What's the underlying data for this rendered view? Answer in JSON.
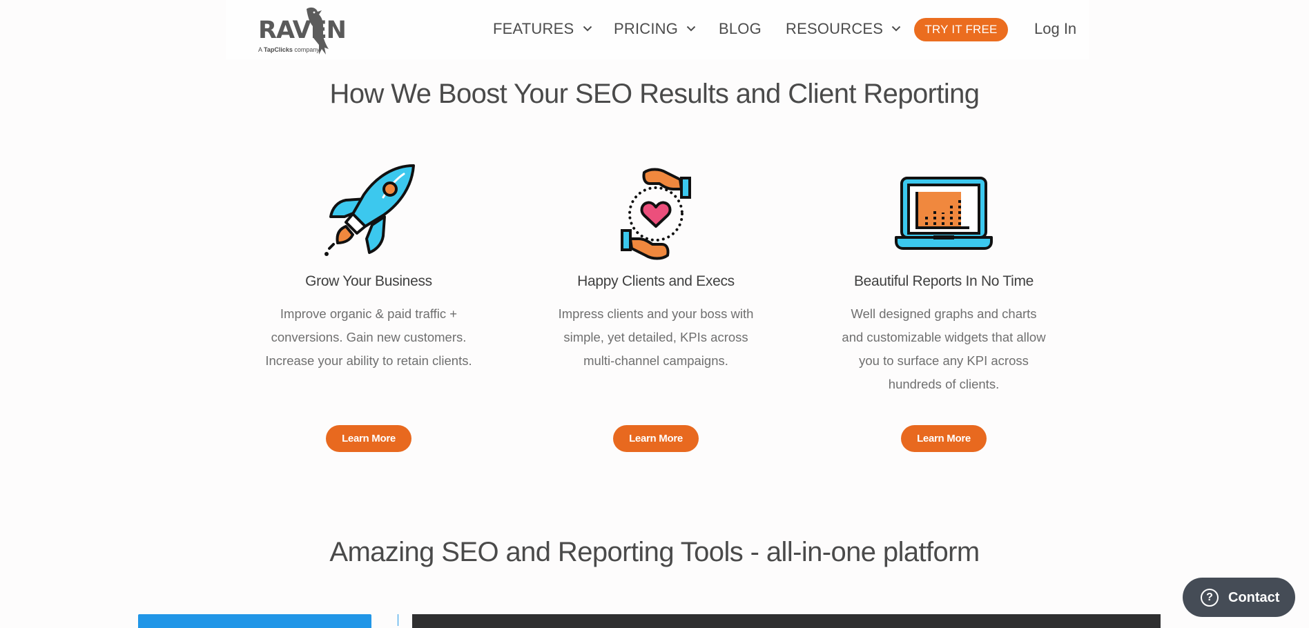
{
  "header": {
    "logo": {
      "word": "RAVEN",
      "sub_prefix": "A ",
      "sub_brand": "TapClicks",
      "sub_suffix": " company"
    },
    "nav": [
      {
        "label": "FEATURES",
        "has_dropdown": true
      },
      {
        "label": "PRICING",
        "has_dropdown": true
      },
      {
        "label": "BLOG",
        "has_dropdown": false
      },
      {
        "label": "RESOURCES",
        "has_dropdown": true
      }
    ],
    "cta_label": "TRY IT FREE",
    "login_label": "Log In"
  },
  "section1": {
    "title": "How We Boost Your SEO Results and Client Reporting",
    "features": [
      {
        "icon": "rocket-icon",
        "title": "Grow Your Business",
        "text": "Improve organic & paid traffic + conversions. Gain new customers. Increase your ability to retain clients.",
        "button": "Learn More"
      },
      {
        "icon": "hands-heart-icon",
        "title": "Happy Clients and Execs",
        "text": "Impress clients and your boss with simple, yet detailed, KPIs across multi-channel campaigns.",
        "button": "Learn More"
      },
      {
        "icon": "laptop-chart-icon",
        "title": "Beautiful Reports In No Time",
        "text": "Well designed graphs and charts and customizable widgets that allow you to surface any KPI across hundreds of clients.",
        "button": "Learn More"
      }
    ]
  },
  "section2": {
    "title": "Amazing SEO and Reporting Tools - all-in-one platform"
  },
  "contact": {
    "label": "Contact",
    "icon_glyph": "?"
  },
  "colors": {
    "brand_orange": "#eb6d1f",
    "accent_blue": "#3cc8ee",
    "text_dark": "#4a4a4a",
    "contact_bg": "#454c56"
  }
}
